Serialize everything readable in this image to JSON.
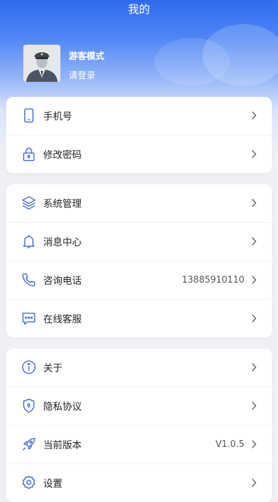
{
  "page": {
    "title": "我的"
  },
  "profile": {
    "name": "游客模式",
    "login_prompt": "请登录"
  },
  "groups": [
    {
      "items": [
        {
          "icon": "phone-icon",
          "label": "手机号"
        },
        {
          "icon": "lock-icon",
          "label": "修改密码"
        }
      ]
    },
    {
      "items": [
        {
          "icon": "layers-icon",
          "label": "系统管理"
        },
        {
          "icon": "bell-icon",
          "label": "消息中心"
        },
        {
          "icon": "telephone-icon",
          "label": "咨询电话",
          "value": "13885910110"
        },
        {
          "icon": "chat-icon",
          "label": "在线客服"
        }
      ]
    },
    {
      "items": [
        {
          "icon": "info-icon",
          "label": "关于"
        },
        {
          "icon": "shield-icon",
          "label": "隐私协议"
        },
        {
          "icon": "rocket-icon",
          "label": "当前版本",
          "value": "V1.0.5"
        },
        {
          "icon": "gear-icon",
          "label": "设置"
        }
      ]
    }
  ],
  "colors": {
    "accent": "#2f6bf0",
    "icon": "#4a6fd1"
  }
}
